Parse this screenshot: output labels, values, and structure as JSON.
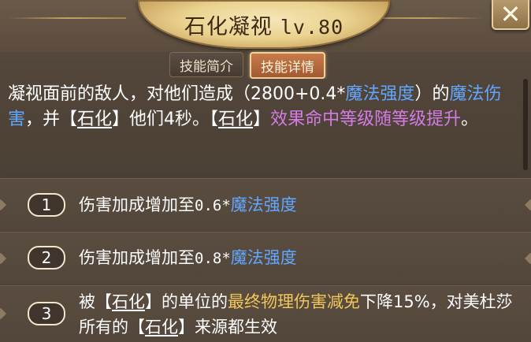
{
  "window": {
    "title": "石化凝视",
    "level": "lv.80",
    "close_icon": "close-icon"
  },
  "tabs": [
    {
      "label": "技能简介",
      "active": false
    },
    {
      "label": "技能详情",
      "active": true
    }
  ],
  "description": {
    "p1": "凝视面前的敌人，对他们造成（2800+0.4*",
    "p1_blue": "魔法强度",
    "p2": "）的",
    "p2_blue": "魔法伤害",
    "p3": "，并【",
    "p3_ul": "石化",
    "p4": "】他们4秒。【",
    "p4_ul": "石化",
    "p5": "】",
    "p5_purple": "效果命中等级随等级提升",
    "p6": "。"
  },
  "upgrades": [
    {
      "index": "1",
      "text": "伤害加成增加至",
      "value": "0.6*",
      "highlight": "魔法强度"
    },
    {
      "index": "2",
      "text": "伤害加成增加至",
      "value": "0.8*",
      "highlight": "魔法强度"
    },
    {
      "index": "3",
      "t1": "被【",
      "t1_ul": "石化",
      "t2": "】的单位的",
      "t2_gold": "最终物理伤害减免",
      "t3": "下降15%，对美杜莎所有的【",
      "t3_ul": "石化",
      "t4": "】来源都生效"
    }
  ],
  "colors": {
    "title_plate": "#ead38f",
    "active_tab": "#c87b4b",
    "blue_text": "#61a7ff",
    "purple_text": "#d57be6",
    "gold_text": "#f2c75a"
  }
}
